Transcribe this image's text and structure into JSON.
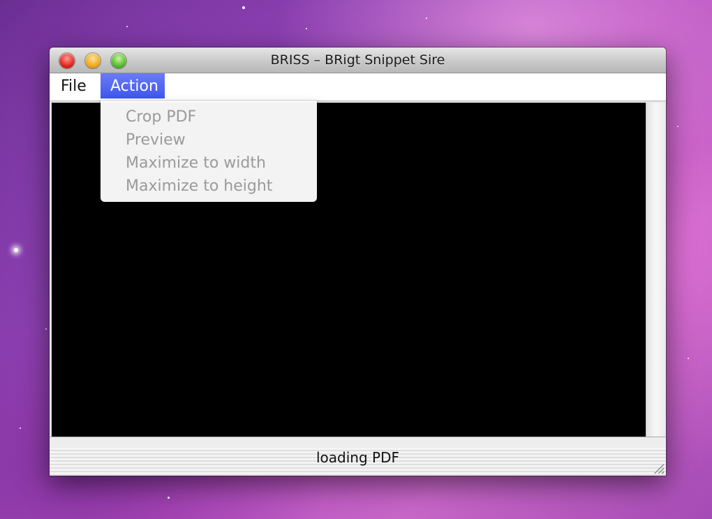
{
  "window": {
    "title": "BRISS – BRigt Snippet Sire"
  },
  "menubar": {
    "file_label": "File",
    "action_label": "Action"
  },
  "action_menu": {
    "items": [
      {
        "label": "Crop PDF",
        "enabled": false
      },
      {
        "label": "Preview",
        "enabled": false
      },
      {
        "label": "Maximize to width",
        "enabled": false
      },
      {
        "label": "Maximize to height",
        "enabled": false
      }
    ]
  },
  "status": {
    "text": "loading PDF"
  },
  "colors": {
    "menu_highlight": "#4a5ff0",
    "disabled_text": "#9a9a9a",
    "content_background": "#000000"
  },
  "icons": [
    "close-button-icon",
    "minimize-button-icon",
    "zoom-button-icon",
    "resize-grip-icon"
  ]
}
